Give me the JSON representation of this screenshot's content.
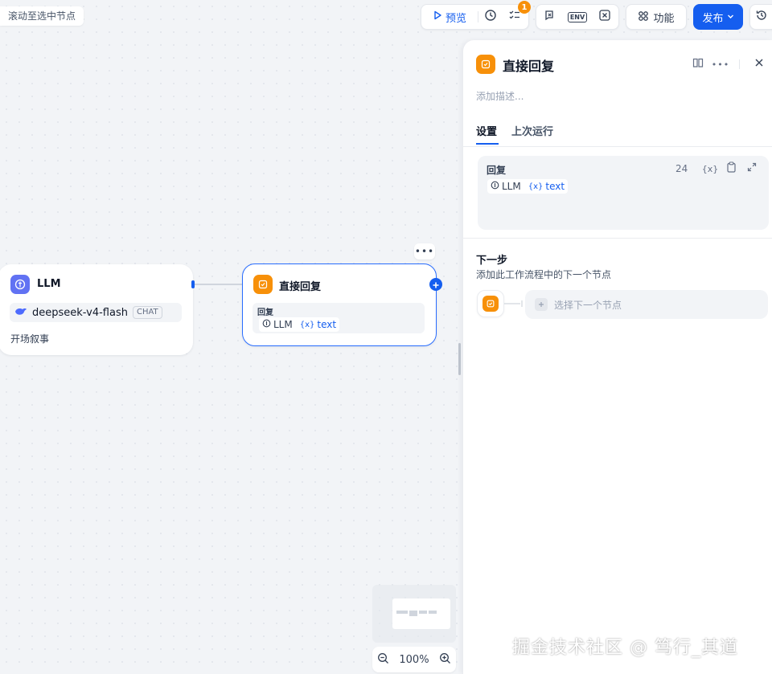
{
  "scroll_hint": "滚动至选中节点",
  "toolbar": {
    "preview_label": "预览",
    "checklist_badge": "1",
    "features_label": "功能",
    "publish_label": "发布",
    "env_label": "ENV",
    "accent_color": "#155eef"
  },
  "canvas": {
    "llm_node": {
      "title": "LLM",
      "model_name": "deepseek-v4-flash",
      "model_mode": "CHAT",
      "description": "开场叙事"
    },
    "answer_node": {
      "title": "直接回复",
      "field_label": "回复",
      "var_source": "LLM",
      "var_name": "text"
    },
    "zoom_level": "100%"
  },
  "panel": {
    "title": "直接回复",
    "description_placeholder": "添加描述...",
    "tabs": [
      {
        "label": "设置",
        "active": true
      },
      {
        "label": "上次运行",
        "active": false
      }
    ],
    "reply": {
      "label": "回复",
      "char_count": "24",
      "var_source": "LLM",
      "var_name": "text"
    },
    "next_step": {
      "title": "下一步",
      "subtitle": "添加此工作流程中的下一个节点",
      "select_placeholder": "选择下一个节点"
    }
  },
  "watermark": "掘金技术社区 @ 笃行_其道"
}
